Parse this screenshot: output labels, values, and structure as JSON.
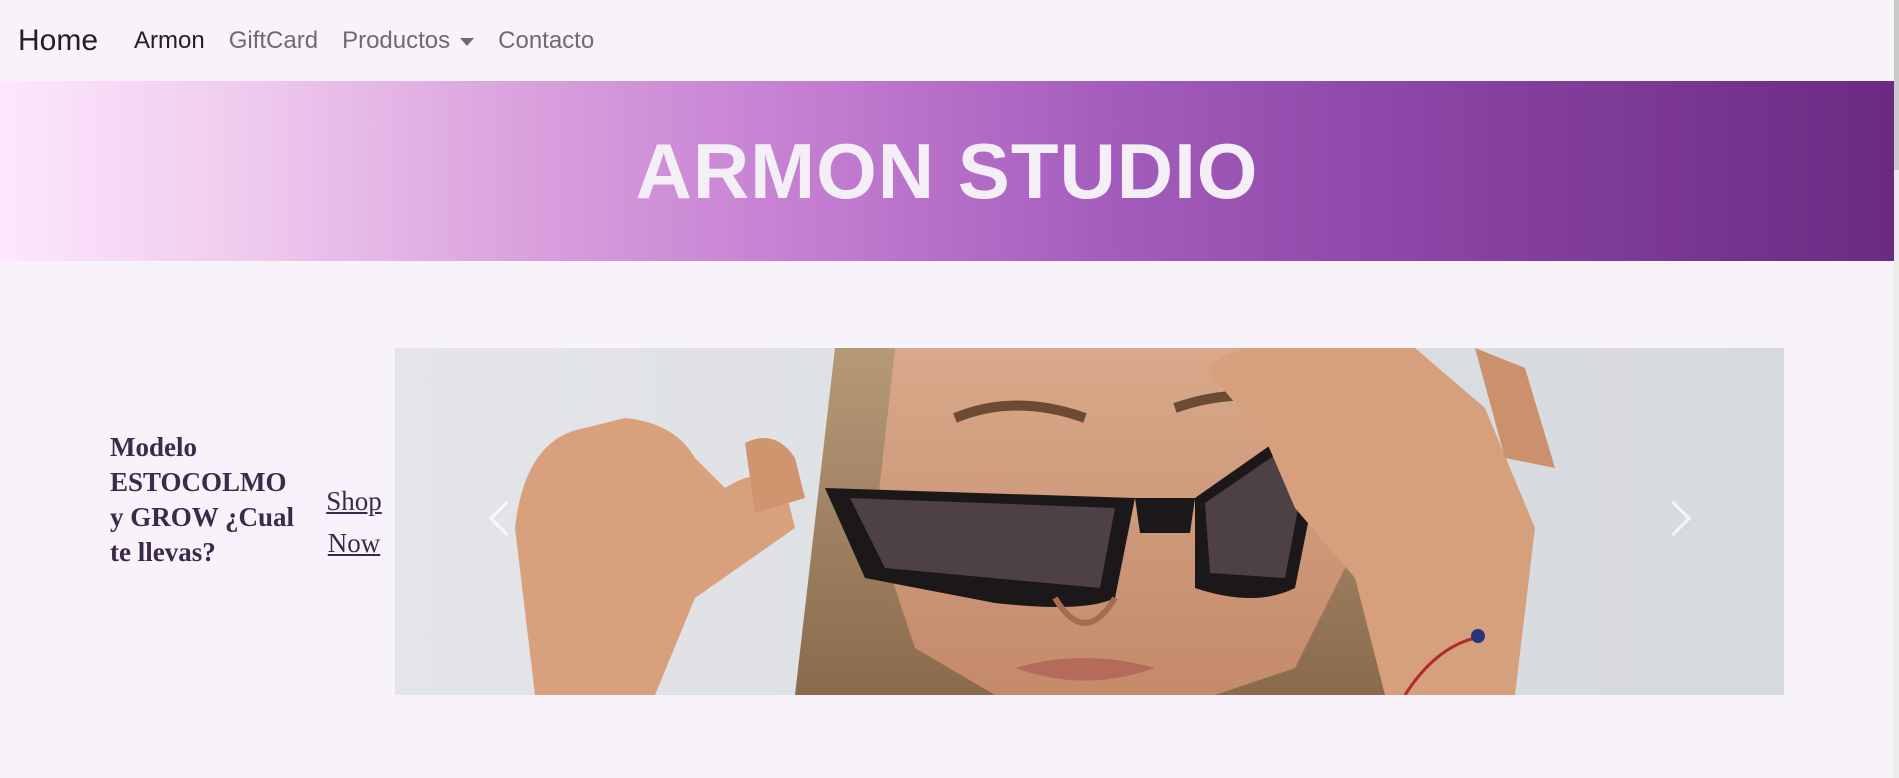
{
  "navbar": {
    "brand": "Home",
    "links": [
      {
        "label": "Armon",
        "active": true
      },
      {
        "label": "GiftCard",
        "active": false
      },
      {
        "label": "Productos",
        "active": false,
        "dropdown": true
      },
      {
        "label": "Contacto",
        "active": false
      }
    ],
    "dropdown_icon": "caret-down-icon"
  },
  "banner": {
    "title": "ARMON STUDIO",
    "gradient_start": "#fde7fd",
    "gradient_end": "#6b2a82"
  },
  "promo": {
    "text": "Modelo ESTOCOLMO y GROW ¿Cual te llevas?",
    "cta": "Shop Now"
  },
  "carousel": {
    "image_alt": "Mujer con lentes de sol negros",
    "prev_icon": "chevron-left-icon",
    "next_icon": "chevron-right-icon"
  },
  "colors": {
    "background": "#f8f3fa",
    "text_dark": "#3c2a4a",
    "nav_muted": "#6f6a72"
  }
}
